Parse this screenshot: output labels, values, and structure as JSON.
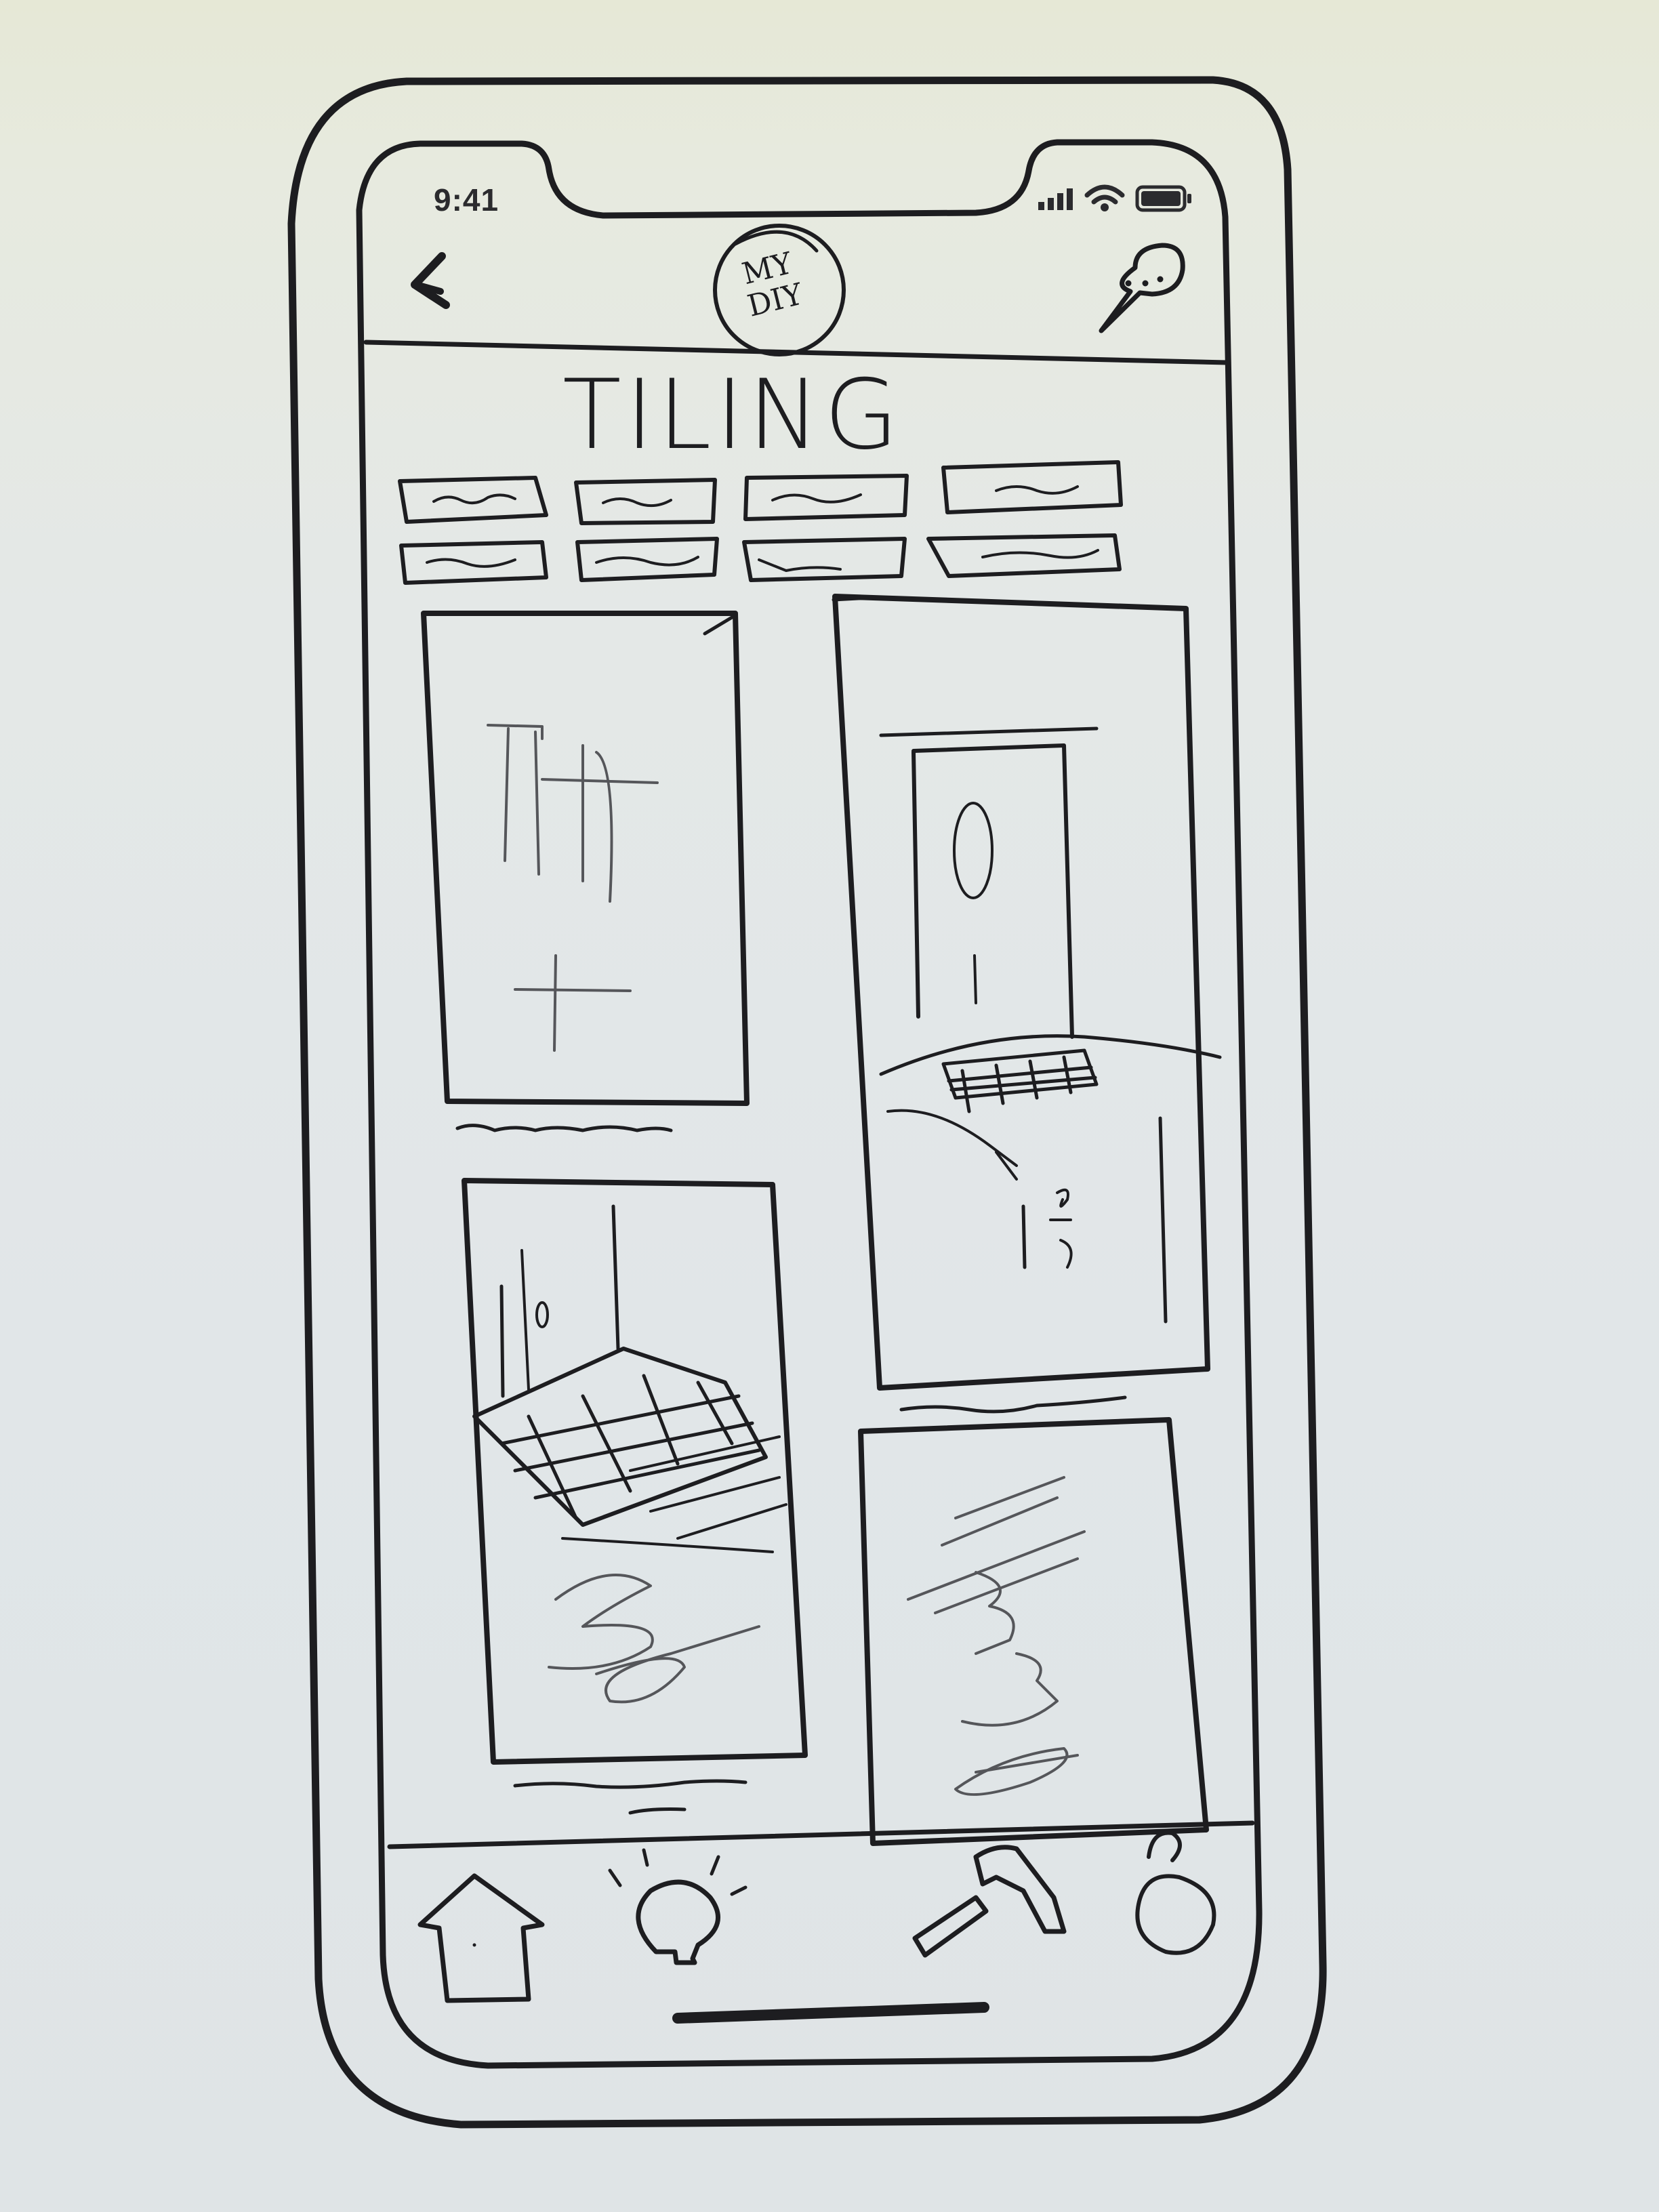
{
  "status_bar": {
    "time": "9:41",
    "icons": [
      "cellular-signal-icon",
      "wifi-icon",
      "battery-icon"
    ]
  },
  "header": {
    "back_icon": "chevron-left-icon",
    "logo_text": "MY DIY",
    "chat_icon": "chat-bubble-icon"
  },
  "page": {
    "title": "TILING"
  },
  "filter_chips": {
    "rows": 2,
    "per_row": 4,
    "labels": [
      "",
      "",
      "",
      "",
      "",
      "",
      "",
      ""
    ]
  },
  "tiles": [
    {
      "name": "tile-wall-tiling",
      "caption": ""
    },
    {
      "name": "tile-bathroom-floor",
      "caption": ""
    },
    {
      "name": "tile-room-floor",
      "caption": ""
    },
    {
      "name": "tile-sketch",
      "caption": ""
    }
  ],
  "tab_bar": {
    "items": [
      "home-icon",
      "ideas-lightbulb-icon",
      "hammer-icon",
      "profile-icon"
    ]
  },
  "colors": {
    "ink": "#1d1d20",
    "paper": "#e3e7e6"
  }
}
